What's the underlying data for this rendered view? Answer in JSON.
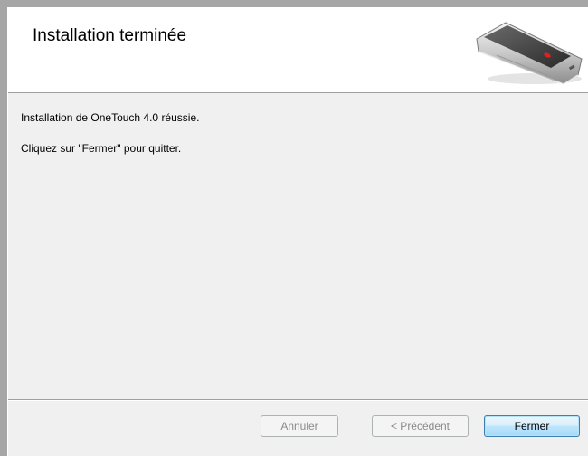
{
  "header": {
    "title": "Installation terminée"
  },
  "body": {
    "line1": "Installation de OneTouch 4.0 réussie.",
    "line2": "Cliquez sur \"Fermer\" pour quitter."
  },
  "buttons": {
    "cancel_label": "Annuler",
    "previous_label": "< Précédent",
    "close_label": "Fermer"
  },
  "icons": {
    "header_image": "scanner-icon"
  },
  "colors": {
    "header_background": "#ffffff",
    "dialog_background": "#f0f0f0",
    "default_button_border": "#3c7fb1"
  }
}
